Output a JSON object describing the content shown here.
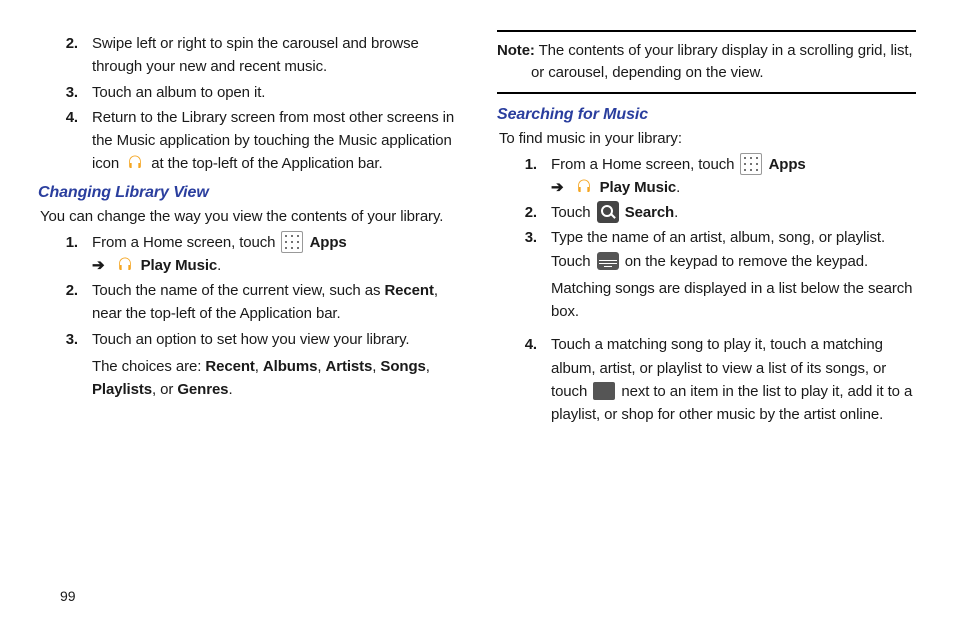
{
  "pageNumber": "99",
  "left": {
    "topSteps": {
      "s2": "Swipe left or right to spin the carousel and browse through your new and recent music.",
      "s3": "Touch an album to open it.",
      "s4a": "Return to the Library screen from most other screens in the Music application by touching the Music application icon ",
      "s4b": " at the top-left of the Application bar."
    },
    "h1": "Changing Library View",
    "intro": "You can change the way you view the contents of your library.",
    "steps": {
      "s1a": "From a Home screen, touch ",
      "apps": "Apps",
      "playMusic": "Play Music",
      "period": ".",
      "s2a": "Touch the name of the current view, such as ",
      "recent": "Recent",
      "s2b": ", near the top-left of the Application bar.",
      "s3": "Touch an option to set how you view your library.",
      "s3sub_a": "The choices are: ",
      "c1": "Recent",
      "c2": "Albums",
      "c3": "Artists",
      "c4": "Songs",
      "c5": "Playlists",
      "c6": "Genres",
      "comma": ", ",
      "or": ", or "
    }
  },
  "right": {
    "noteLabel": "Note:",
    "noteText": " The contents of your library display in a scrolling grid, list, or carousel, depending on the view.",
    "h1": "Searching for Music",
    "intro": "To find music in your library:",
    "steps": {
      "s1a": "From a Home screen, touch ",
      "apps": "Apps",
      "playMusic": "Play Music",
      "period": ".",
      "s2a": "Touch ",
      "search": "Search",
      "s3a": "Type the name of an artist, album, song, or playlist. Touch ",
      "s3b": " on the keypad to remove the keypad.",
      "s3sub": "Matching songs are displayed in a list below the search box.",
      "s4a": "Touch a matching song to play it, touch a matching album, artist, or playlist to view a list of its songs, or touch ",
      "s4b": " next to an item in the list to play it, add it to a playlist, or shop for other music by the artist online."
    }
  }
}
